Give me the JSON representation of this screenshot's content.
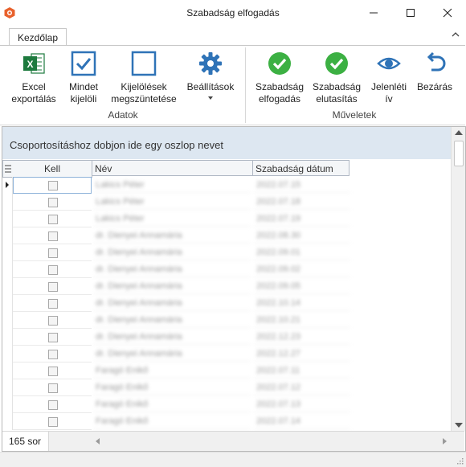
{
  "window": {
    "title": "Szabadság elfogadás",
    "minimize_glyph": "—",
    "maximize_glyph": "☐",
    "close_glyph": "✕"
  },
  "ribbon": {
    "tabs": [
      {
        "label": "Kezdőlap",
        "active": true
      }
    ],
    "groups": [
      {
        "label": "Adatok",
        "buttons": [
          {
            "label": "Excel\nexportálás",
            "icon": "excel-icon"
          },
          {
            "label": "Mindet\nkijelöli",
            "icon": "checked-box-icon"
          },
          {
            "label": "Kijelölések\nmegszüntetése",
            "icon": "empty-box-icon"
          },
          {
            "label": "Beállítások",
            "icon": "gear-icon",
            "has_dropdown": true
          }
        ]
      },
      {
        "label": "Műveletek",
        "buttons": [
          {
            "label": "Szabadság\nelfogadás",
            "icon": "green-check-icon"
          },
          {
            "label": "Szabadság\nelutasítás",
            "icon": "green-check-icon"
          },
          {
            "label": "Jelenléti\nív",
            "icon": "eye-icon"
          },
          {
            "label": "Bezárás",
            "icon": "undo-arrow-icon"
          }
        ]
      }
    ]
  },
  "grid": {
    "group_panel_text": "Csoportosításhoz dobjon ide egy oszlop nevet",
    "columns": [
      "Kell",
      "Név",
      "Szabadság dátum"
    ],
    "rows": [
      {
        "kell": false,
        "nev": "Lakics Péter",
        "datum": "2022.07.15"
      },
      {
        "kell": false,
        "nev": "Lakics Péter",
        "datum": "2022.07.18"
      },
      {
        "kell": false,
        "nev": "Lakics Péter",
        "datum": "2022.07.19"
      },
      {
        "kell": false,
        "nev": "dr. Dienyei Annamária",
        "datum": "2022.08.30"
      },
      {
        "kell": false,
        "nev": "dr. Dienyei Annamária",
        "datum": "2022.09.01"
      },
      {
        "kell": false,
        "nev": "dr. Dienyei Annamária",
        "datum": "2022.09.02"
      },
      {
        "kell": false,
        "nev": "dr. Dienyei Annamária",
        "datum": "2022.09.05"
      },
      {
        "kell": false,
        "nev": "dr. Dienyei Annamária",
        "datum": "2022.10.14"
      },
      {
        "kell": false,
        "nev": "dr. Dienyei Annamária",
        "datum": "2022.10.21"
      },
      {
        "kell": false,
        "nev": "dr. Dienyei Annamária",
        "datum": "2022.12.23"
      },
      {
        "kell": false,
        "nev": "dr. Dienyei Annamária",
        "datum": "2022.12.27"
      },
      {
        "kell": false,
        "nev": "Faragó Enikő",
        "datum": "2022.07.11"
      },
      {
        "kell": false,
        "nev": "Faragó Enikő",
        "datum": "2022.07.12"
      },
      {
        "kell": false,
        "nev": "Faragó Enikő",
        "datum": "2022.07.13"
      },
      {
        "kell": false,
        "nev": "Faragó Enikő",
        "datum": "2022.07.14"
      }
    ],
    "row_count_label": "165 sor"
  },
  "colors": {
    "accent_green": "#3cb043",
    "accent_blue": "#2f73b7",
    "group_panel_bg": "#dde7f1",
    "app_icon": "#e8612c"
  }
}
